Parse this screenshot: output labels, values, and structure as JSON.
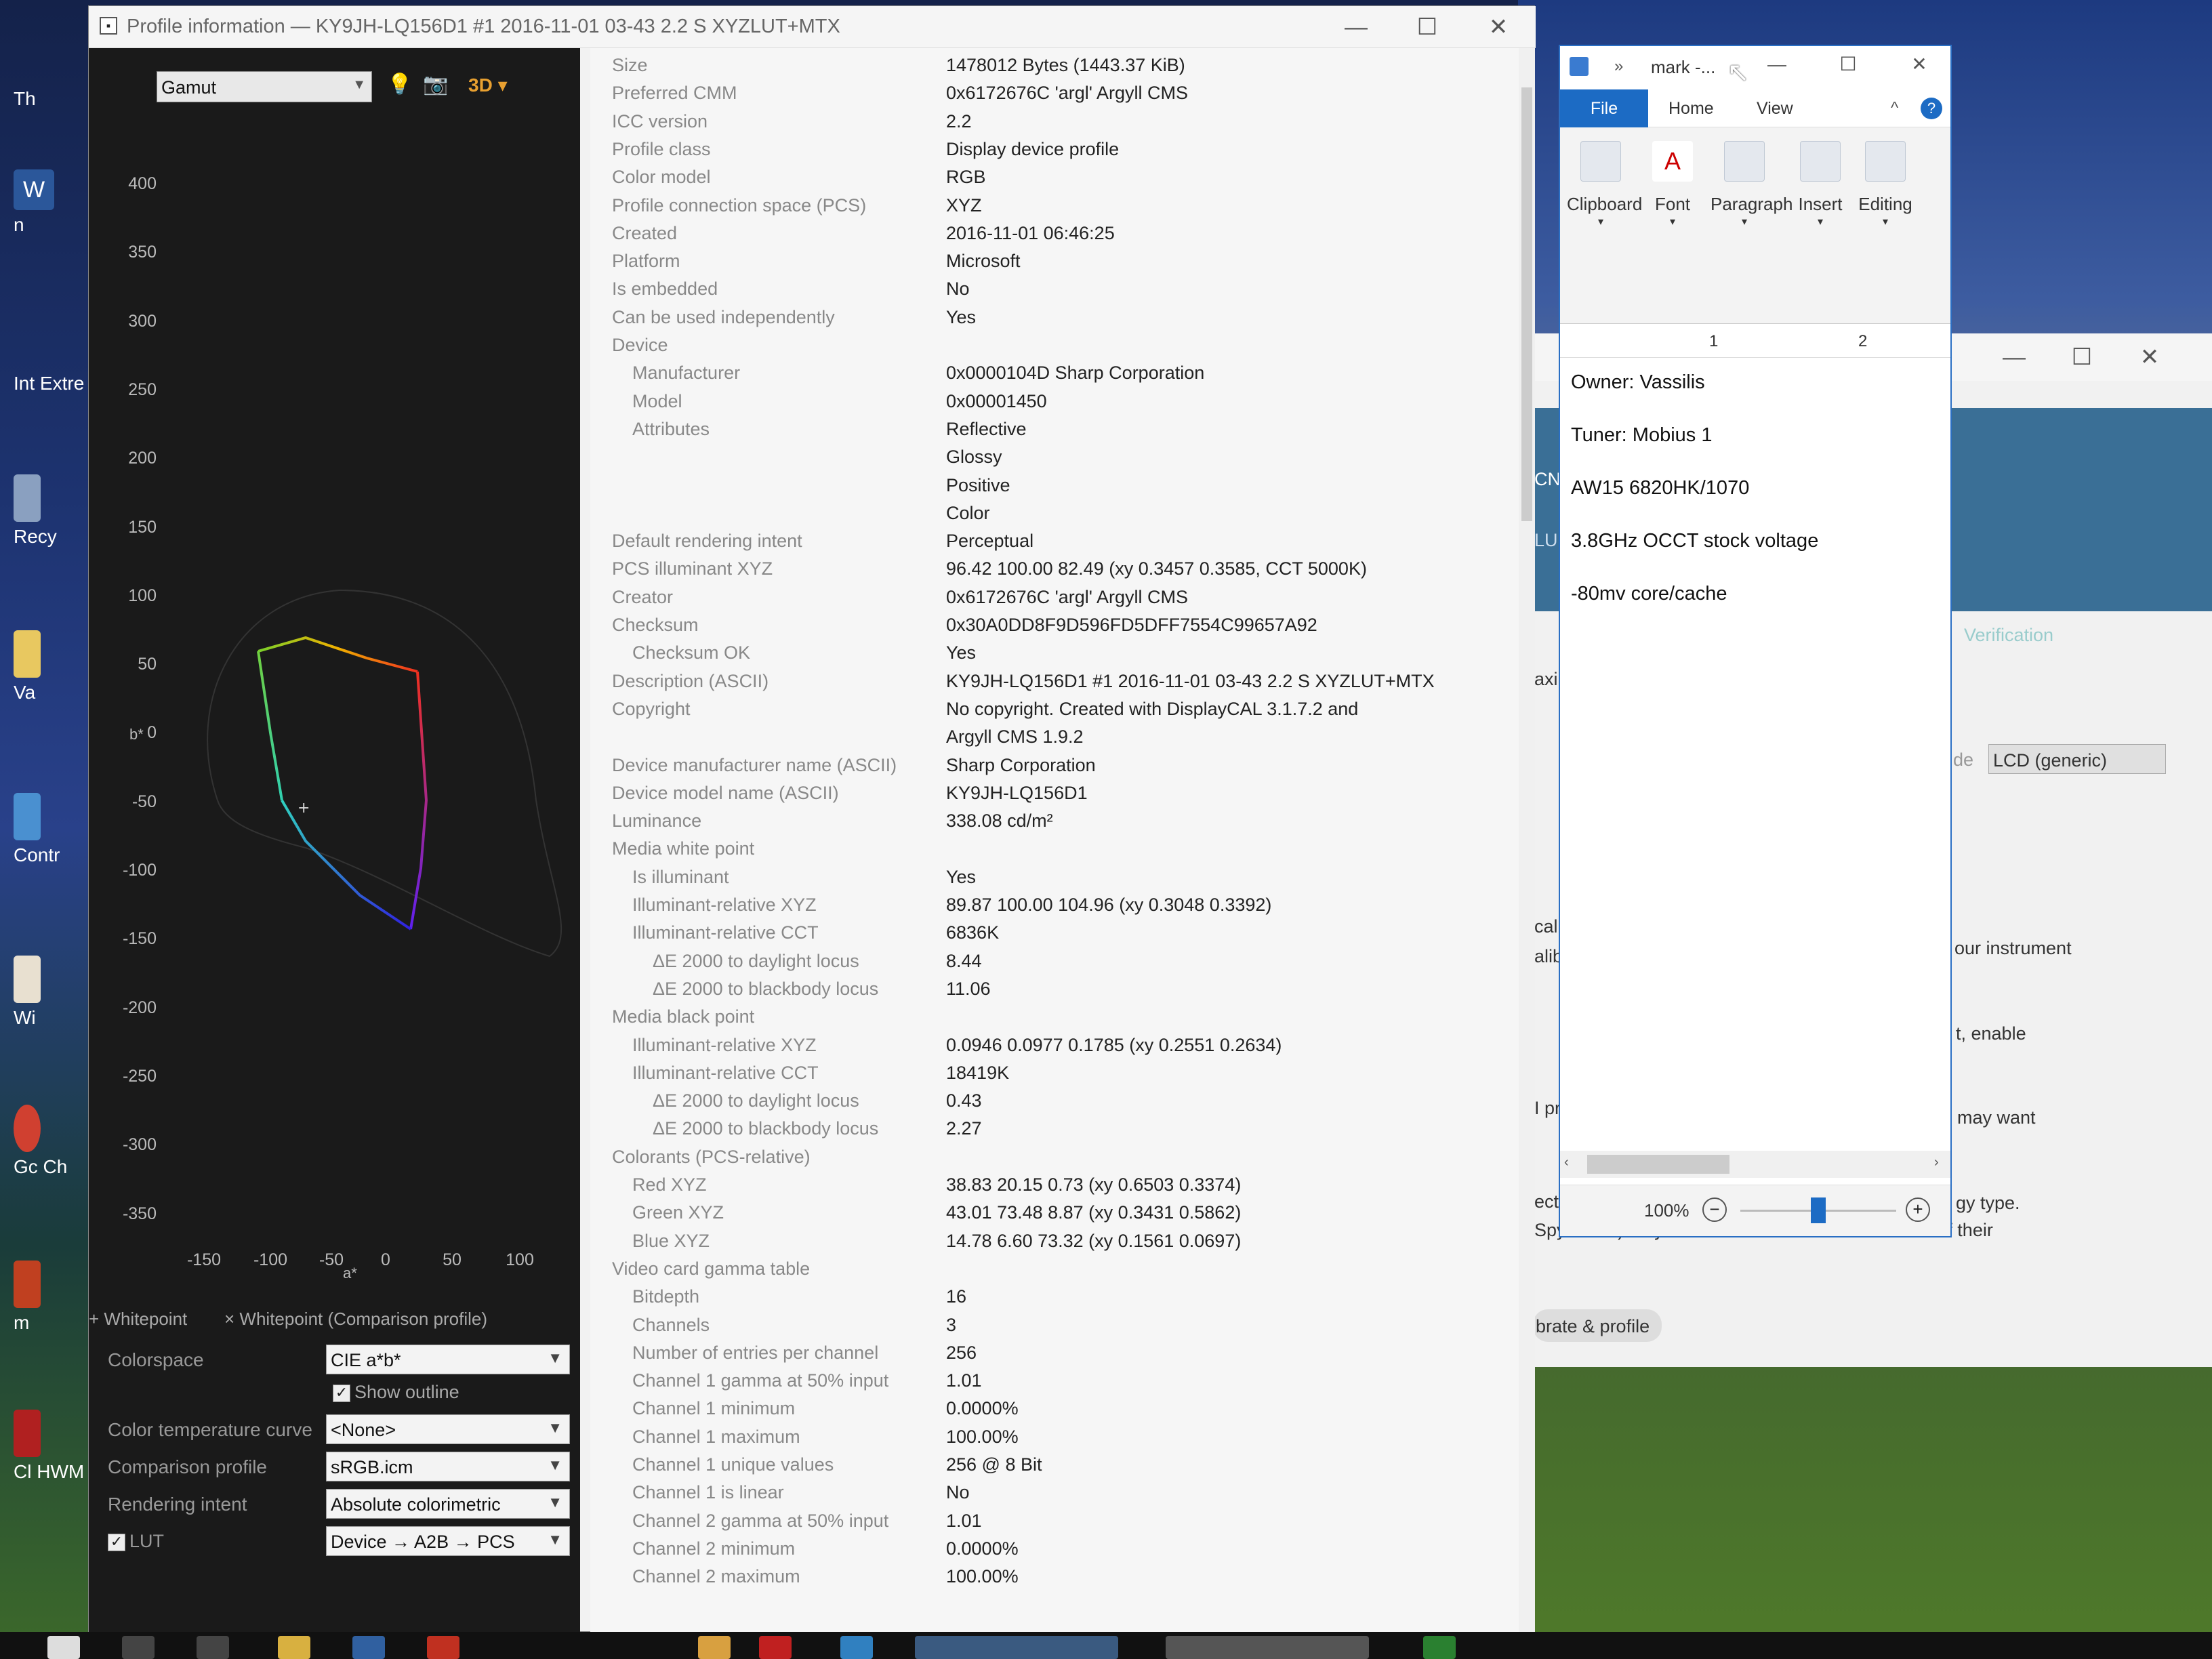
{
  "desktop": {
    "icons": [
      "Th",
      "W",
      "n",
      "Int Extre",
      "Recy",
      "Va",
      "Contr",
      "Wi",
      "Gc Ch",
      "m",
      "Cl HWM"
    ]
  },
  "profile_window": {
    "title": "Profile information — KY9JH-LQ156D1 #1 2016-11-01 03-43 2.2 S XYZLUT+MTX",
    "minimize": "—",
    "maximize": "☐",
    "close": "✕",
    "plot_select": "Gamut",
    "view_3d_label": "3D",
    "y_ticks": [
      "400",
      "350",
      "300",
      "250",
      "200",
      "150",
      "100",
      "50",
      "0",
      "-50",
      "-100",
      "-150",
      "-200",
      "-250",
      "-300",
      "-350"
    ],
    "x_ticks": [
      "-150",
      "-100",
      "-50",
      "0",
      "50",
      "100"
    ],
    "x_axis_label": "a*",
    "y_axis_label": "b*",
    "legend_whitepoint": "Whitepoint",
    "legend_whitepoint_comparison": "Whitepoint (Comparison profile)",
    "controls": {
      "colorspace_label": "Colorspace",
      "colorspace_value": "CIE a*b*",
      "show_outline_label": "Show outline",
      "color_temp_label": "Color temperature curve",
      "color_temp_value": "<None>",
      "comparison_label": "Comparison profile",
      "comparison_value": "sRGB.icm",
      "intent_label": "Rendering intent",
      "intent_value": "Absolute colorimetric",
      "lut_label": "LUT",
      "lut_value": "Device → A2B → PCS"
    },
    "info_rows": [
      {
        "k": "Size",
        "v": "1478012 Bytes (1443.37 KiB)",
        "indent": 0
      },
      {
        "k": "Preferred CMM",
        "v": "0x6172676C 'argl' Argyll CMS",
        "indent": 0
      },
      {
        "k": "ICC version",
        "v": "2.2",
        "indent": 0
      },
      {
        "k": "Profile class",
        "v": "Display device profile",
        "indent": 0
      },
      {
        "k": "Color model",
        "v": "RGB",
        "indent": 0
      },
      {
        "k": "Profile connection space (PCS)",
        "v": "XYZ",
        "indent": 0
      },
      {
        "k": "Created",
        "v": "2016-11-01 06:46:25",
        "indent": 0
      },
      {
        "k": "Platform",
        "v": "Microsoft",
        "indent": 0
      },
      {
        "k": "Is embedded",
        "v": "No",
        "indent": 0
      },
      {
        "k": "Can be used independently",
        "v": "Yes",
        "indent": 0
      },
      {
        "k": "Device",
        "v": "",
        "indent": 0
      },
      {
        "k": "Manufacturer",
        "v": "0x0000104D Sharp Corporation",
        "indent": 1
      },
      {
        "k": "Model",
        "v": "0x00001450",
        "indent": 1
      },
      {
        "k": "Attributes",
        "v": "Reflective",
        "indent": 1
      },
      {
        "k": "",
        "v": "Glossy",
        "indent": 1
      },
      {
        "k": "",
        "v": "Positive",
        "indent": 1
      },
      {
        "k": "",
        "v": "Color",
        "indent": 1
      },
      {
        "k": "Default rendering intent",
        "v": "Perceptual",
        "indent": 0
      },
      {
        "k": "PCS illuminant XYZ",
        "v": "96.42 100.00  82.49 (xy 0.3457 0.3585, CCT 5000K)",
        "indent": 0
      },
      {
        "k": "Creator",
        "v": "0x6172676C 'argl' Argyll CMS",
        "indent": 0
      },
      {
        "k": "Checksum",
        "v": "0x30A0DD8F9D596FD5DFF7554C99657A92",
        "indent": 0
      },
      {
        "k": "Checksum OK",
        "v": "Yes",
        "indent": 1
      },
      {
        "k": "Description (ASCII)",
        "v": "KY9JH-LQ156D1 #1 2016-11-01 03-43 2.2 S XYZLUT+MTX",
        "indent": 0
      },
      {
        "k": "Copyright",
        "v": "No copyright. Created with DisplayCAL 3.1.7.2 and",
        "indent": 0
      },
      {
        "k": "",
        "v": "Argyll CMS 1.9.2",
        "indent": 0
      },
      {
        "k": "Device manufacturer name (ASCII)",
        "v": "Sharp Corporation",
        "indent": 0
      },
      {
        "k": "Device model name (ASCII)",
        "v": "KY9JH-LQ156D1",
        "indent": 0
      },
      {
        "k": "Luminance",
        "v": "338.08 cd/m²",
        "indent": 0
      },
      {
        "k": "Media white point",
        "v": "",
        "indent": 0
      },
      {
        "k": "Is illuminant",
        "v": "Yes",
        "indent": 1
      },
      {
        "k": "Illuminant-relative XYZ",
        "v": "89.87 100.00 104.96 (xy 0.3048 0.3392)",
        "indent": 1
      },
      {
        "k": "Illuminant-relative CCT",
        "v": "6836K",
        "indent": 1
      },
      {
        "k": "ΔE 2000 to daylight locus",
        "v": "8.44",
        "indent": 2
      },
      {
        "k": "ΔE 2000 to blackbody locus",
        "v": "11.06",
        "indent": 2
      },
      {
        "k": "Media black point",
        "v": "",
        "indent": 0
      },
      {
        "k": "Illuminant-relative XYZ",
        "v": "0.0946 0.0977 0.1785 (xy 0.2551 0.2634)",
        "indent": 1
      },
      {
        "k": "Illuminant-relative CCT",
        "v": "18419K",
        "indent": 1
      },
      {
        "k": "ΔE 2000 to daylight locus",
        "v": "0.43",
        "indent": 2
      },
      {
        "k": "ΔE 2000 to blackbody locus",
        "v": "2.27",
        "indent": 2
      },
      {
        "k": "Colorants (PCS-relative)",
        "v": "",
        "indent": 0
      },
      {
        "k": "Red XYZ",
        "v": "38.83  20.15   0.73 (xy 0.6503 0.3374)",
        "indent": 1
      },
      {
        "k": "Green XYZ",
        "v": "43.01  73.48   8.87 (xy 0.3431 0.5862)",
        "indent": 1
      },
      {
        "k": "Blue XYZ",
        "v": "14.78   6.60  73.32 (xy 0.1561 0.0697)",
        "indent": 1
      },
      {
        "k": "Video card gamma table",
        "v": "",
        "indent": 0
      },
      {
        "k": "Bitdepth",
        "v": "16",
        "indent": 1
      },
      {
        "k": "Channels",
        "v": "3",
        "indent": 1
      },
      {
        "k": "Number of entries per channel",
        "v": "256",
        "indent": 1
      },
      {
        "k": "Channel 1 gamma at 50% input",
        "v": "1.01",
        "indent": 1
      },
      {
        "k": "Channel 1 minimum",
        "v": "0.0000%",
        "indent": 1
      },
      {
        "k": "Channel 1 maximum",
        "v": "100.00%",
        "indent": 1
      },
      {
        "k": "Channel 1 unique values",
        "v": "256 @ 8 Bit",
        "indent": 1
      },
      {
        "k": "Channel 1 is linear",
        "v": "No",
        "indent": 1
      },
      {
        "k": "Channel 2 gamma at 50% input",
        "v": "1.01",
        "indent": 1
      },
      {
        "k": "Channel 2 minimum",
        "v": "0.0000%",
        "indent": 1
      },
      {
        "k": "Channel 2 maximum",
        "v": "100.00%",
        "indent": 1
      }
    ]
  },
  "behind_window": {
    "texts": [
      "CN",
      "LU",
      "axi",
      "LCD (generic)",
      "Verification",
      "de",
      "cal",
      "alib",
      "our instrument",
      "t, enable",
      "I pr",
      "may want",
      "ect",
      "gy type.",
      "Spyder4/5) may have a correction built into some of their",
      "brate & profile"
    ]
  },
  "wordpad": {
    "title": "mark -...",
    "tab_file": "File",
    "tab_home": "Home",
    "tab_view": "View",
    "help": "?",
    "ribbon": [
      "Clipboard",
      "Font",
      "Paragraph",
      "Insert",
      "Editing"
    ],
    "ruler": [
      "1",
      "2"
    ],
    "lines": [
      "Owner: Vassilis",
      "Tuner: Mobius 1",
      "AW15 6820HK/1070",
      "3.8GHz OCCT stock voltage",
      "-80mv core/cache"
    ],
    "zoom": "100%",
    "zoom_level_fraction": 0.5
  }
}
